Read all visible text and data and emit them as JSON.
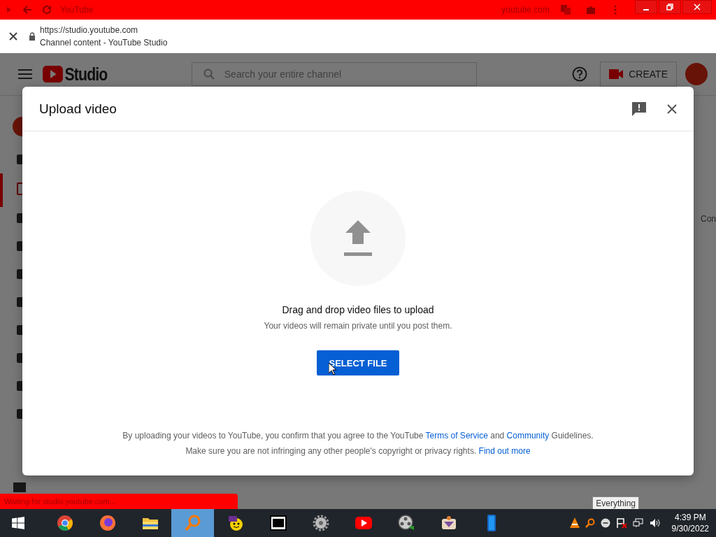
{
  "browser": {
    "tab_title": "YouTube",
    "site": "youtube.com",
    "url": "https://studio.youtube.com",
    "page_title": "Channel content - YouTube Studio",
    "status": "Waiting for studio.youtube.com..."
  },
  "studio": {
    "logo": "Studio",
    "search": {
      "placeholder": "Search your entire channel"
    },
    "create_button": "CREATE",
    "side_text": "Con"
  },
  "dialog": {
    "title": "Upload video",
    "heading": "Drag and drop video files to upload",
    "subtext": "Your videos will remain private until you post them.",
    "button": "SELECT FILE",
    "legal": [
      [
        {
          "text": "By uploading your videos to YouTube, you confirm that you agree to the YouTube ",
          "link": false
        },
        {
          "text": "Terms of Service",
          "link": true
        },
        {
          "text": " and ",
          "link": false
        },
        {
          "text": "Community",
          "link": true
        },
        {
          "text": " Guidelines.",
          "link": false
        }
      ],
      [
        {
          "text": "Make sure you are not infringing any other people's copyright or privacy rights. ",
          "link": false
        },
        {
          "text": "Find out more",
          "link": true
        }
      ]
    ]
  },
  "taskbar": {
    "apps": [
      {
        "kind": "chrome",
        "selected": false
      },
      {
        "kind": "firefox",
        "selected": false
      },
      {
        "kind": "folder",
        "selected": false
      },
      {
        "kind": "search",
        "selected": true
      },
      {
        "kind": "messenger",
        "selected": false
      },
      {
        "kind": "archive",
        "selected": false
      },
      {
        "kind": "gear",
        "selected": false
      },
      {
        "kind": "youtube",
        "selected": false
      },
      {
        "kind": "film",
        "selected": false
      },
      {
        "kind": "paint",
        "selected": false
      },
      {
        "kind": "phone",
        "selected": false
      }
    ],
    "tooltip": "Everything",
    "time": "4:39 PM",
    "date": "9/30/2022"
  }
}
